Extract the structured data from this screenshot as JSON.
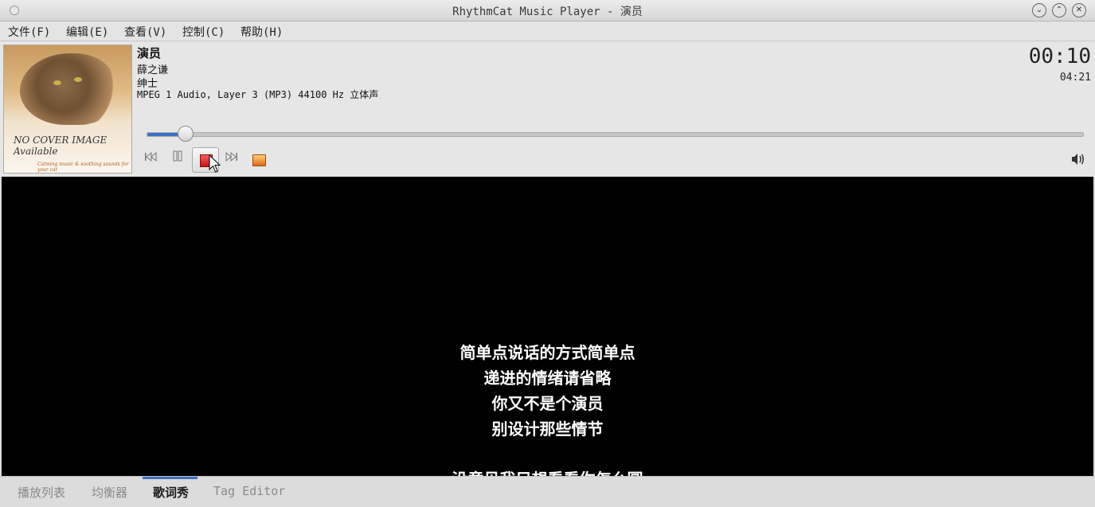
{
  "window": {
    "title": "RhythmCat Music Player - 演员"
  },
  "menu": [
    {
      "label": "文件(F)"
    },
    {
      "label": "编辑(E)"
    },
    {
      "label": "查看(V)"
    },
    {
      "label": "控制(C)"
    },
    {
      "label": "帮助(H)"
    }
  ],
  "track": {
    "title": "演员",
    "artist": "薛之谦",
    "album": "绅士",
    "format": "MPEG 1 Audio, Layer 3 (MP3) 44100 Hz 立体声",
    "current_time": "00:10",
    "total_time": "04:21",
    "progress": 0.04
  },
  "cover": {
    "text_line1": "NO COVER IMAGE",
    "text_line2": "Available",
    "tagline": "Calming music & soothing sounds for your cat"
  },
  "controls": {
    "icons": [
      "previous-icon",
      "pause-icon",
      "stop-icon",
      "next-icon",
      "open-folder-icon",
      "volume-icon"
    ],
    "accent_color": "#3c72c8",
    "stop_color": "#e02020"
  },
  "lyrics": {
    "lines": [
      "简单点说话的方式简单点",
      "递进的情绪请省略",
      "你又不是个演员",
      "别设计那些情节",
      "",
      "没意见我只想看看你怎么圆"
    ]
  },
  "tabs": [
    {
      "label": "播放列表",
      "active": false
    },
    {
      "label": "均衡器",
      "active": false
    },
    {
      "label": "歌词秀",
      "active": true
    },
    {
      "label": "Tag Editor",
      "active": false
    }
  ]
}
